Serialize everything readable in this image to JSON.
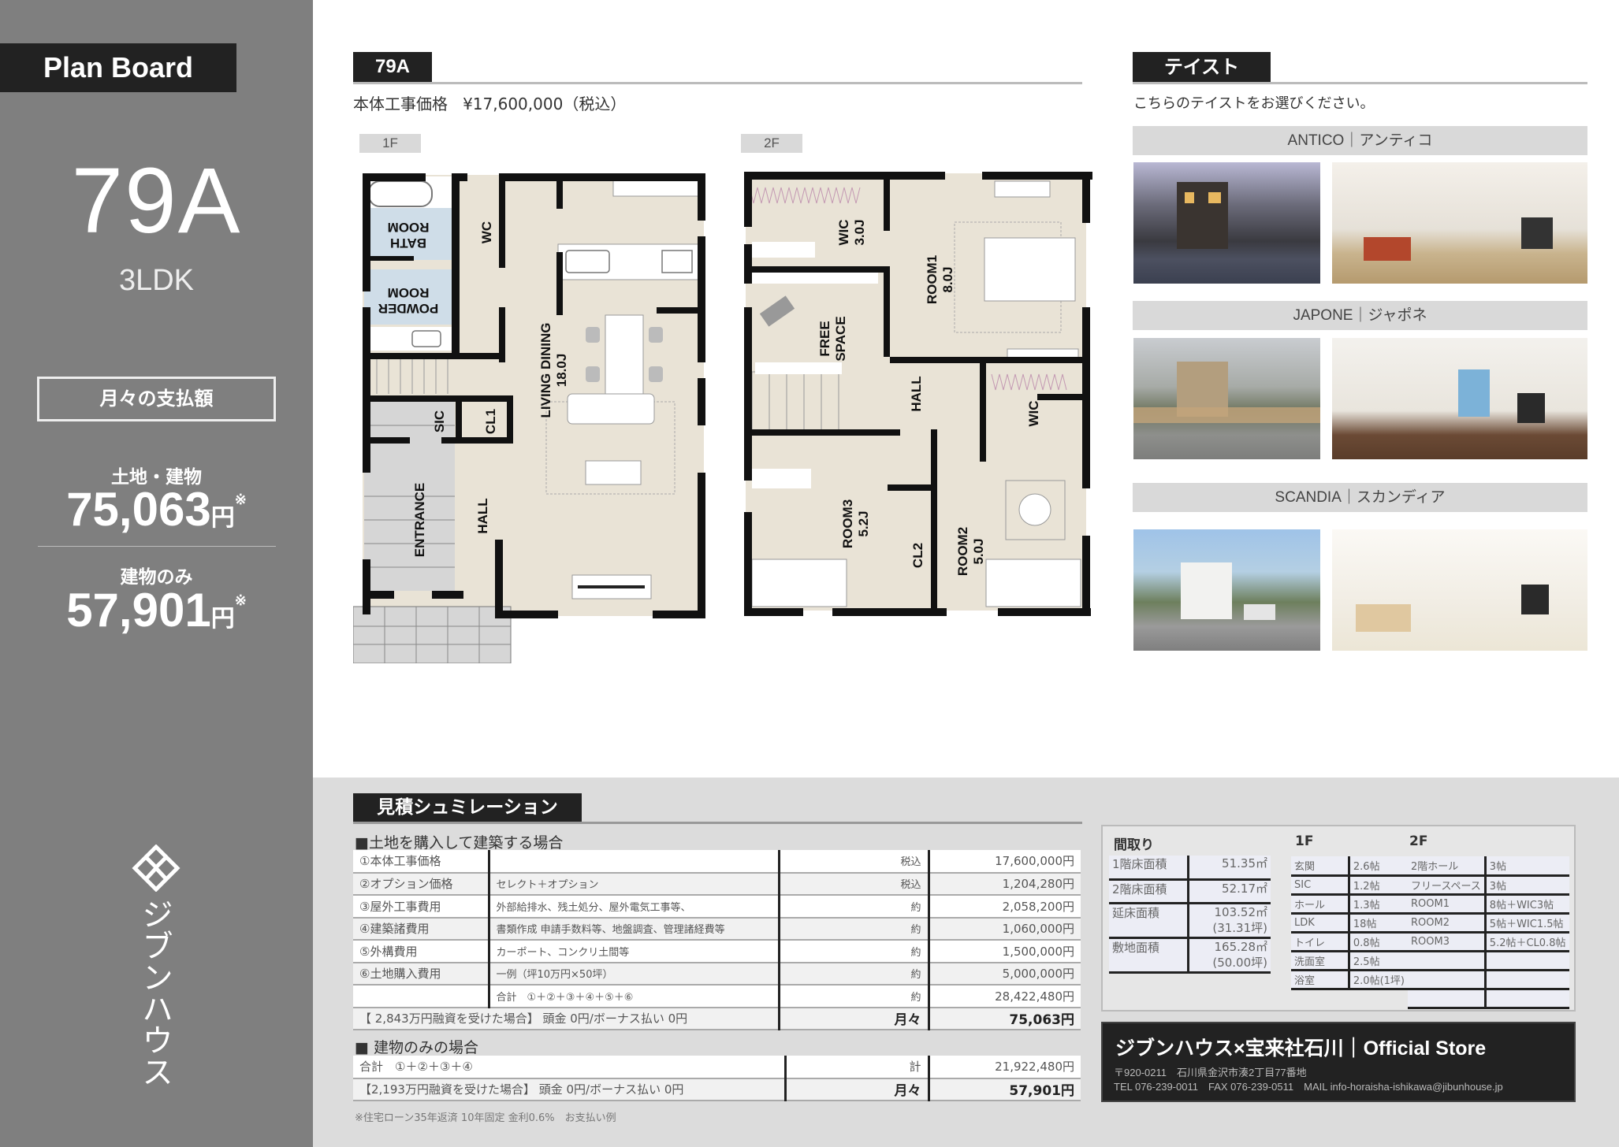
{
  "sidebar": {
    "plan_board_label": "Plan Board",
    "plan_code": "79A",
    "plan_type": "3LDK",
    "monthly_label": "月々の支払額",
    "land_building_label": "土地・建物",
    "land_building_value": "75,063",
    "building_only_label": "建物のみ",
    "building_only_value": "57,901",
    "unit": "円",
    "note_mark": "※",
    "brand_name": "ジブンハウス"
  },
  "plan": {
    "header": "79A",
    "price_label": "本体工事価格",
    "price_value": "¥17,600,000（税込）",
    "floor1_tag": "1F",
    "floor2_tag": "2F",
    "floor1_rooms": {
      "bath": [
        "BATH",
        "ROOM"
      ],
      "wc": "WC",
      "powder": [
        "POWDER",
        "ROOM"
      ],
      "living": [
        "LIVING DINING",
        "18.0J"
      ],
      "sic": "SIC",
      "cl1": "CL1",
      "entrance": "ENTRANCE",
      "hall": "HALL"
    },
    "floor2_rooms": {
      "wic1": [
        "WIC",
        "3.0J"
      ],
      "room1": [
        "ROOM1",
        "8.0J"
      ],
      "free": [
        "FREE",
        "SPACE"
      ],
      "hall": "HALL",
      "wic2": "WIC",
      "room3": [
        "ROOM3",
        "5.2J"
      ],
      "cl2": "CL2",
      "room2": [
        "ROOM2",
        "5.0J"
      ]
    }
  },
  "taste": {
    "header": "テイスト",
    "subtitle": "こちらのテイストをお選びください。",
    "options": [
      {
        "label": "ANTICO｜アンティコ",
        "exterior_alt": "ANTICO exterior at dusk",
        "interior_alt": "ANTICO living room"
      },
      {
        "label": "JAPONE｜ジャポネ",
        "exterior_alt": "JAPONE exterior",
        "interior_alt": "JAPONE living room"
      },
      {
        "label": "SCANDIA｜スカンディア",
        "exterior_alt": "SCANDIA exterior",
        "interior_alt": "SCANDIA living room"
      }
    ]
  },
  "estimate": {
    "header": "見積シュミレーション",
    "land_case_title": "■土地を購入して建築する場合",
    "land_rows": [
      {
        "item": "①本体工事価格",
        "desc": "",
        "qual": "税込",
        "amount": "17,600,000円"
      },
      {
        "item": "②オプション価格",
        "desc": "セレクト＋オプション",
        "qual": "税込",
        "amount": "1,204,280円"
      },
      {
        "item": "③屋外工事費用",
        "desc": "外部給排水、残土処分、屋外電気工事等、",
        "qual": "約",
        "amount": "2,058,200円"
      },
      {
        "item": "④建築諸費用",
        "desc": "書類作成 申請手数料等、地盤調査、管理諸経費等",
        "qual": "約",
        "amount": "1,060,000円"
      },
      {
        "item": "⑤外構費用",
        "desc": "カーポート、コンクリ土間等",
        "qual": "約",
        "amount": "1,500,000円"
      },
      {
        "item": "⑥土地購入費用",
        "desc": "一例（坪10万円×50坪）",
        "qual": "約",
        "amount": "5,000,000円"
      },
      {
        "item": "",
        "desc": "合計　①＋②＋③＋④＋⑤＋⑥",
        "qual": "約",
        "amount": "28,422,480円"
      }
    ],
    "land_loan": {
      "text": "【 2,843万円融資を受けた場合】 頭金 0円/ボーナス払い 0円",
      "qual": "月々",
      "amount": "75,063円"
    },
    "building_case_title": "■ 建物のみの場合",
    "building_total": {
      "text": "合計　①＋②＋③＋④",
      "qual": "計",
      "amount": "21,922,480円"
    },
    "building_loan": {
      "text": "【2,193万円融資を受けた場合】 頭金 0円/ボーナス払い 0円",
      "qual": "月々",
      "amount": "57,901円"
    },
    "footnote": "※住宅ローン35年返済 10年固定 金利0.6%　お支払い例"
  },
  "madori": {
    "title": "間取り",
    "areas": [
      {
        "label": "1階床面積",
        "value": "51.35㎡",
        "sub": ""
      },
      {
        "label": "2階床面積",
        "value": "52.17㎡",
        "sub": ""
      },
      {
        "label": "延床面積",
        "value": "103.52㎡",
        "sub": "(31.31坪)"
      },
      {
        "label": "敷地面積",
        "value": "165.28㎡",
        "sub": "(50.00坪)"
      }
    ],
    "floor1_title": "1F",
    "floor1": [
      {
        "room": "玄関",
        "size": "2.6帖"
      },
      {
        "room": "SIC",
        "size": "1.2帖"
      },
      {
        "room": "ホール",
        "size": "1.3帖"
      },
      {
        "room": "LDK",
        "size": "18帖"
      },
      {
        "room": "トイレ",
        "size": "0.8帖"
      },
      {
        "room": "洗面室",
        "size": "2.5帖"
      },
      {
        "room": "浴室",
        "size": "2.0帖(1坪)"
      }
    ],
    "floor2_title": "2F",
    "floor2": [
      {
        "room": "2階ホール",
        "size": "3帖"
      },
      {
        "room": "フリースペース",
        "size": "3帖"
      },
      {
        "room": "ROOM1",
        "size": "8帖＋WIC3帖"
      },
      {
        "room": "ROOM2",
        "size": "5帖＋WIC1.5帖"
      },
      {
        "room": "ROOM3",
        "size": "5.2帖＋CL0.8帖"
      },
      {
        "room": "",
        "size": ""
      },
      {
        "room": "",
        "size": ""
      },
      {
        "room": "",
        "size": ""
      }
    ]
  },
  "store": {
    "title": "ジブンハウス×宝来社石川｜Official Store",
    "address": "〒920-0211　石川県金沢市湊2丁目77番地",
    "contact": "TEL 076-239-0011　FAX 076-239-0511　MAIL info-horaisha-ishikawa@jibunhouse.jp"
  },
  "colors": {
    "sidebar_bg": "#7f7f7f",
    "header_bg": "#222222",
    "floor_fill": "#e9e3d6",
    "wet_area_fill": "#cfdde8",
    "band_bg": "#d9d9d9",
    "bottom_bg": "#dcdcdc"
  }
}
